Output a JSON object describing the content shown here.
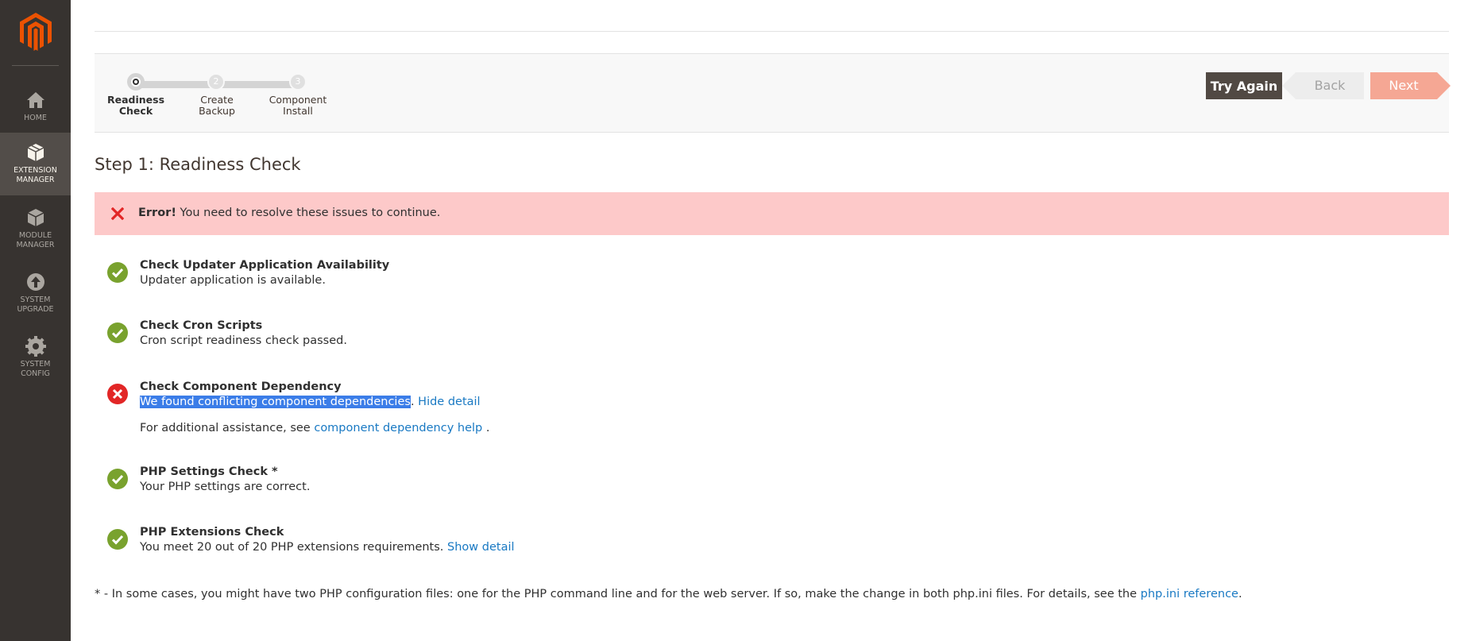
{
  "sidebar": {
    "items": [
      {
        "label": "HOME",
        "icon": "home-icon",
        "active": false
      },
      {
        "label": "EXTENSION\nMANAGER",
        "icon": "extension-icon",
        "active": true
      },
      {
        "label": "MODULE\nMANAGER",
        "icon": "module-icon",
        "active": false
      },
      {
        "label": "SYSTEM\nUPGRADE",
        "icon": "upgrade-icon",
        "active": false
      },
      {
        "label": "SYSTEM\nCONFIG",
        "icon": "gear-icon",
        "active": false
      }
    ]
  },
  "wizard": {
    "steps": [
      {
        "number": "1",
        "label": "Readiness\nCheck",
        "current": true
      },
      {
        "number": "2",
        "label": "Create\nBackup",
        "current": false
      },
      {
        "number": "3",
        "label": "Component\nInstall",
        "current": false
      }
    ],
    "buttons": {
      "try_again": "Try Again",
      "back": "Back",
      "next": "Next"
    }
  },
  "page": {
    "title": "Step 1: Readiness Check",
    "error": {
      "label": "Error!",
      "message": "You need to resolve these issues to continue."
    }
  },
  "checks": [
    {
      "title": "Check Updater Application Availability",
      "status": "success",
      "description": "Updater application is available."
    },
    {
      "title": "Check Cron Scripts",
      "status": "success",
      "description": "Cron script readiness check passed."
    },
    {
      "title": "Check Component Dependency",
      "status": "error",
      "description_selected": "We found conflicting component dependencies",
      "description_suffix": ".",
      "link": "Hide detail",
      "help_prefix": "For additional assistance, see",
      "help_link": "component dependency help",
      "help_suffix": "."
    },
    {
      "title": "PHP Settings Check *",
      "status": "success",
      "description": "Your PHP settings are correct."
    },
    {
      "title": "PHP Extensions Check",
      "status": "success",
      "description": "You meet 20 out of 20 PHP extensions requirements.",
      "link": "Show detail"
    }
  ],
  "footnote": {
    "text": "* - In some cases, you might have two PHP configuration files: one for the PHP command line and for the web server. If so, make the change in both php.ini files. For details, see the",
    "link": "php.ini reference",
    "suffix": "."
  },
  "colors": {
    "sidebar_bg": "#373330",
    "logo": "#eb5202",
    "success": "#79a22e",
    "error": "#e22626",
    "link": "#1979c3",
    "error_banner": "#fdc9c9"
  }
}
